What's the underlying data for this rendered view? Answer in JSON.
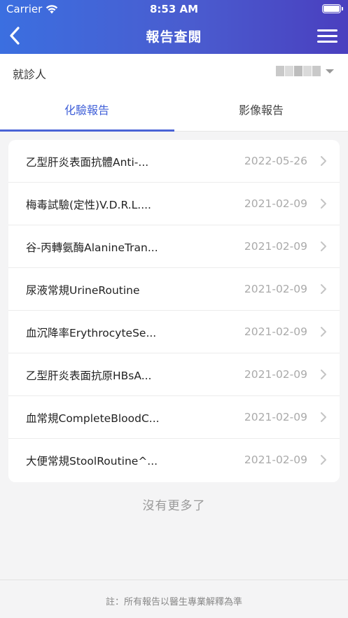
{
  "status_bar": {
    "carrier": "Carrier",
    "time": "8:53 AM"
  },
  "nav": {
    "title": "報告查閱",
    "back_icon": "chevron-left-icon",
    "menu_icon": "hamburger-menu-icon"
  },
  "patient": {
    "label": "就診人"
  },
  "tabs": [
    {
      "label": "化驗報告",
      "active": true
    },
    {
      "label": "影像報告",
      "active": false
    }
  ],
  "reports": [
    {
      "name": "乙型肝炎表面抗體Anti-...",
      "date": "2022-05-26"
    },
    {
      "name": "梅毒試驗(定性)V.D.R.L....",
      "date": "2021-02-09"
    },
    {
      "name": "谷-丙轉氨酶AlanineTran...",
      "date": "2021-02-09"
    },
    {
      "name": "尿液常規UrineRoutine",
      "date": "2021-02-09"
    },
    {
      "name": "血沉降率ErythrocyteSe...",
      "date": "2021-02-09"
    },
    {
      "name": "乙型肝炎表面抗原HBsA...",
      "date": "2021-02-09"
    },
    {
      "name": "血常規CompleteBloodC...",
      "date": "2021-02-09"
    },
    {
      "name": "大便常規StoolRoutine^...",
      "date": "2021-02-09"
    }
  ],
  "list_end_text": "沒有更多了",
  "footer_note": "註：所有報告以醫生專業解釋為準",
  "colors": {
    "accent": "#4a63d6",
    "header_start": "#3b6fe0",
    "header_end": "#4a3fbf"
  }
}
